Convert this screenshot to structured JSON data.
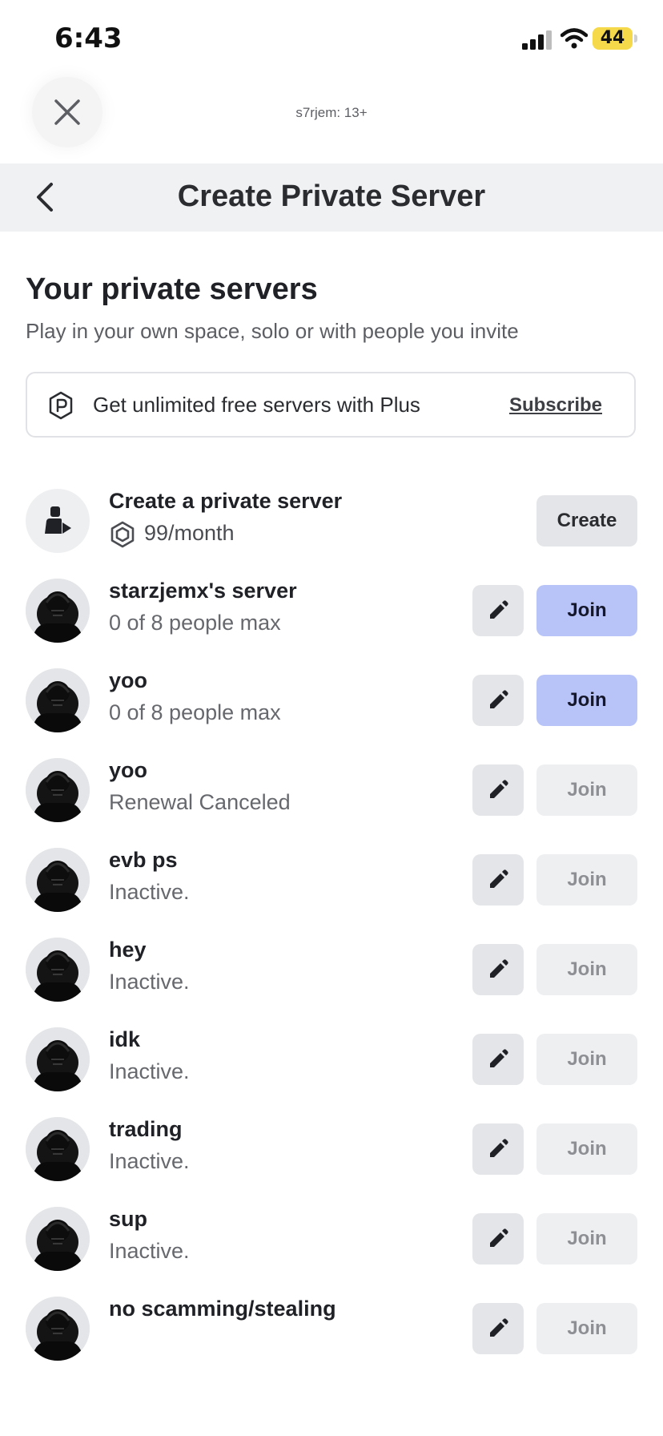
{
  "status_bar": {
    "time": "6:43",
    "battery": "44"
  },
  "overlay": {
    "title": "s7rjem: 13+"
  },
  "header": {
    "title": "Create Private Server"
  },
  "section": {
    "title": "Your private servers",
    "subtitle": "Play in your own space, solo or with people you invite"
  },
  "plus_banner": {
    "text": "Get unlimited free servers with Plus",
    "link": "Subscribe"
  },
  "create_row": {
    "title": "Create a private server",
    "price": "99/month",
    "button": "Create"
  },
  "servers": [
    {
      "name": "starzjemx's server",
      "status": "0 of 8 people max",
      "join": "Join"
    },
    {
      "name": "yoo",
      "status": "0 of 8 people max",
      "join": "Join"
    },
    {
      "name": "yoo",
      "status": "Renewal Canceled",
      "join": "Join"
    },
    {
      "name": "evb ps",
      "status": "Inactive.",
      "join": "Join"
    },
    {
      "name": "hey",
      "status": "Inactive.",
      "join": "Join"
    },
    {
      "name": "idk",
      "status": "Inactive.",
      "join": "Join"
    },
    {
      "name": "trading",
      "status": "Inactive.",
      "join": "Join"
    },
    {
      "name": "sup",
      "status": "Inactive.",
      "join": "Join"
    },
    {
      "name": "no scamming/stealing",
      "status": "",
      "join": "Join"
    }
  ],
  "colors": {
    "join_active": "#b8c3f8",
    "join_inactive": "#eeeff1",
    "header_bg": "#f0f1f2"
  },
  "icons": {
    "close": "close-icon",
    "back": "chevron-left-icon",
    "plus": "plus-logo-icon",
    "robux": "robux-icon",
    "edit": "pencil-icon",
    "create_server": "person-play-icon"
  }
}
